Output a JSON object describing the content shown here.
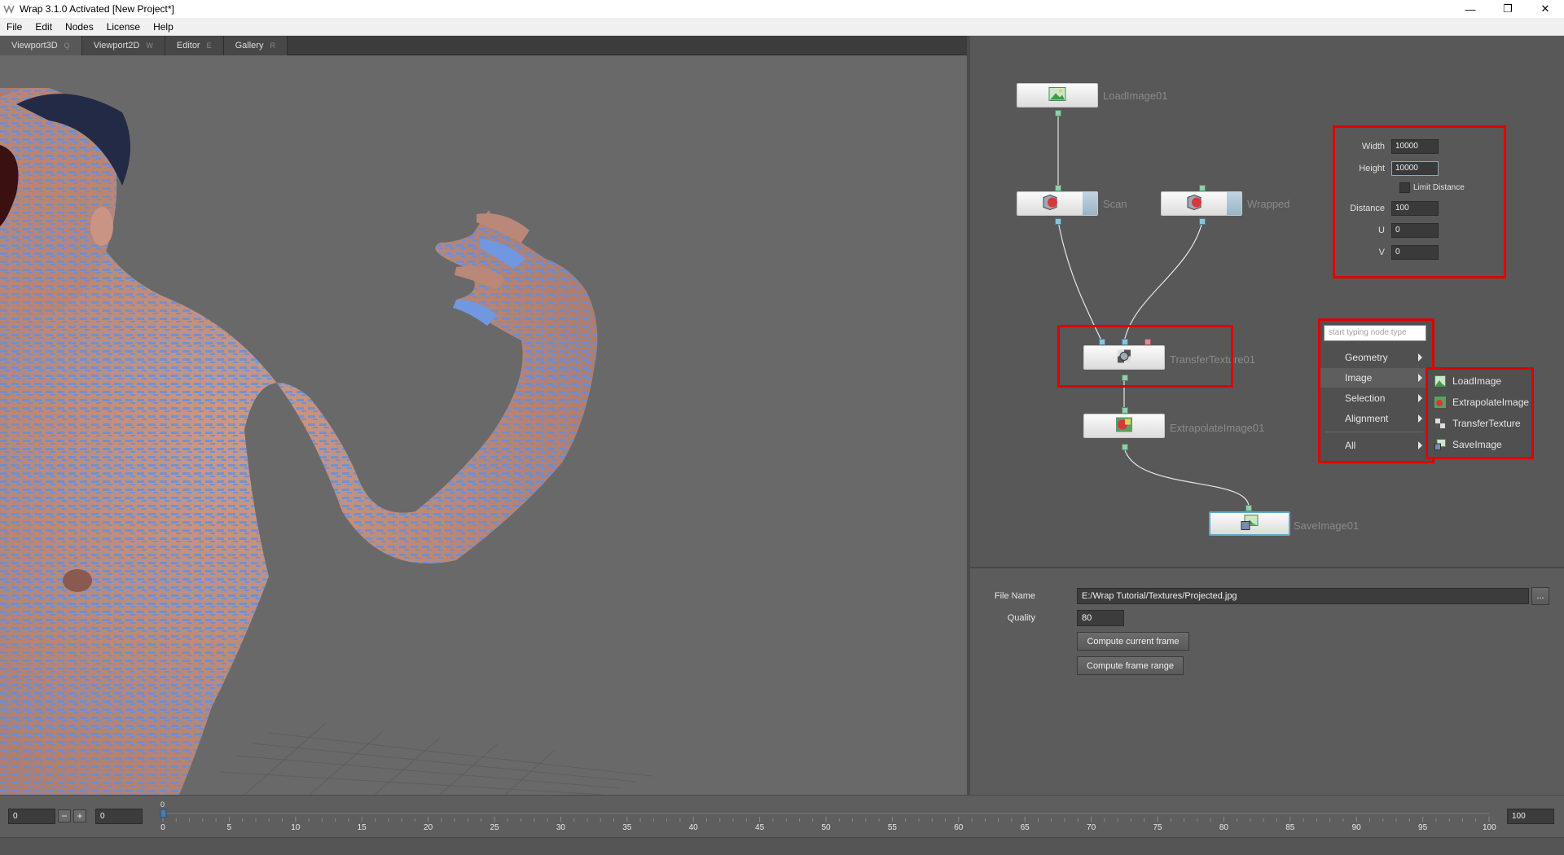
{
  "window": {
    "title": "Wrap 3.1.0 Activated [New Project*]",
    "controls": {
      "minimize": "—",
      "restore": "❐",
      "close": "✕"
    }
  },
  "menu": [
    "File",
    "Edit",
    "Nodes",
    "License",
    "Help"
  ],
  "tabs": [
    {
      "label": "Viewport3D",
      "shortcut": "Q"
    },
    {
      "label": "Viewport2D",
      "shortcut": "W"
    },
    {
      "label": "Editor",
      "shortcut": "E"
    },
    {
      "label": "Gallery",
      "shortcut": "R"
    }
  ],
  "nodes": {
    "load_image": "LoadImage01",
    "scan": "Scan",
    "wrapped": "Wrapped",
    "transfer_texture": "TransferTexture01",
    "extrapolate_image": "ExtrapolateImage01",
    "save_image": "SaveImage01"
  },
  "params": {
    "width_label": "Width",
    "width_value": "10000",
    "height_label": "Height",
    "height_value": "10000",
    "limit_distance_label": "Limit Distance",
    "distance_label": "Distance",
    "distance_value": "100",
    "u_label": "U",
    "u_value": "0",
    "v_label": "V",
    "v_value": "0"
  },
  "context_menu": {
    "search_placeholder": "start typing node type",
    "items": [
      "Geometry",
      "Image",
      "Selection",
      "Alignment",
      "All"
    ],
    "image_submenu": [
      "LoadImage",
      "ExtrapolateImage",
      "TransferTexture",
      "SaveImage"
    ]
  },
  "properties": {
    "file_name_label": "File Name",
    "file_name_value": "E:/Wrap Tutorial/Textures/Projected.jpg",
    "browse_label": "...",
    "quality_label": "Quality",
    "quality_value": "80",
    "compute_current_label": "Compute current frame",
    "compute_range_label": "Compute frame range"
  },
  "timeline": {
    "start_value": "0",
    "current_value": "0",
    "end_value": "100",
    "minus_label": "−",
    "plus_label": "+",
    "playhead_value": "0",
    "tick_labels": [
      "0",
      "5",
      "10",
      "15",
      "20",
      "25",
      "30",
      "35",
      "40",
      "45",
      "50",
      "55",
      "60",
      "65",
      "70",
      "75",
      "80",
      "85",
      "90",
      "95",
      "100"
    ]
  }
}
